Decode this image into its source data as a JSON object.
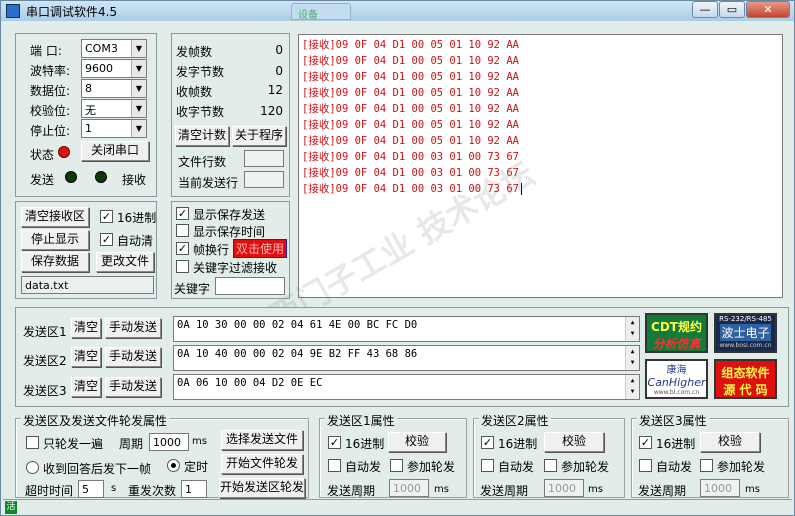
{
  "window": {
    "title": "串口调试软件4.5",
    "ghost_tab": "设备"
  },
  "serial": {
    "port_label": "端  口:",
    "port_value": "COM3",
    "baud_label": "波特率:",
    "baud_value": "9600",
    "databits_label": "数据位:",
    "databits_value": "8",
    "parity_label": "校验位:",
    "parity_value": "无",
    "stopbits_label": "停止位:",
    "stopbits_value": "1",
    "status_label": "状态",
    "close_port_button": "关闭串口",
    "send_label": "发送",
    "recv_label": "接收",
    "status_color": "#e01010"
  },
  "stats": {
    "tx_frames_label": "发帧数",
    "tx_frames": "0",
    "tx_bytes_label": "发字节数",
    "tx_bytes": "0",
    "rx_frames_label": "收帧数",
    "rx_frames": "12",
    "rx_bytes_label": "收字节数",
    "rx_bytes": "120",
    "clear_count_button": "清空计数",
    "about_button": "关于程序",
    "file_lines_label": "文件行数",
    "current_line_label": "当前发送行"
  },
  "recv_controls": {
    "clear_button": "清空接收区",
    "hex_label": "16进制",
    "stop_display_button": "停止显示",
    "auto_clear_label": "自动清",
    "save_data_button": "保存数据",
    "change_file_button": "更改文件",
    "filename": "data.txt"
  },
  "display_options": {
    "show_save_send": "显示保存发送",
    "show_save_time": "显示保存时间",
    "frame_newline": "帧换行",
    "frame_newline_badge": "双击使用",
    "keyword_filter": "关键字过滤接收",
    "keyword_label": "关键字"
  },
  "receive_rows": [
    "[接收]09 0F 04 D1 00 05 01 10 92 AA",
    "[接收]09 0F 04 D1 00 05 01 10 92 AA",
    "[接收]09 0F 04 D1 00 05 01 10 92 AA",
    "[接收]09 0F 04 D1 00 05 01 10 92 AA",
    "[接收]09 0F 04 D1 00 05 01 10 92 AA",
    "[接收]09 0F 04 D1 00 05 01 10 92 AA",
    "[接收]09 0F 04 D1 00 05 01 10 92 AA",
    "[接收]09 0F 04 D1 00 03 01 00 73 67",
    "[接收]09 0F 04 D1 00 03 01 00 73 67",
    "[接收]09 0F 04 D1 00 03 01 00 73 67"
  ],
  "send_areas": [
    {
      "label": "发送区1",
      "clear": "清空",
      "manual": "手动发送",
      "content": "0A 10 30 00 00 02 04 61 4E 00 BC FC D0"
    },
    {
      "label": "发送区2",
      "clear": "清空",
      "manual": "手动发送",
      "content": "0A 10 40 00 00 02 04 9E B2 FF 43  68 86"
    },
    {
      "label": "发送区3",
      "clear": "清空",
      "manual": "手动发送",
      "content": "0A 06 10 00 04 D2 0E EC"
    }
  ],
  "ads": {
    "ad1_line1": "CDT规约",
    "ad1_line2": "分析仿真",
    "ad2_line1": "RS-232/RS-485",
    "ad2_line2": "波士电子",
    "ad2_line3": "www.bosi.com.cn",
    "ad3_line1": "康海",
    "ad3_line2": "CanHigher",
    "ad3_line3": "www.bl.com.cn",
    "ad4_line1": "组态软件",
    "ad4_line2": "源 代 码"
  },
  "send_file_props": {
    "title": "发送区及发送文件轮发属性",
    "send_once": "只轮发一遍",
    "period_label": "周期",
    "period_value": "1000",
    "ms": "ms",
    "select_file_button": "选择发送文件",
    "reply_next": "收到回答后发下一帧",
    "timed": "定时",
    "start_file_button": "开始文件轮发",
    "timeout_label": "超时时间",
    "timeout_value": "5",
    "s": "s",
    "resend_label": "重发次数",
    "resend_value": "1",
    "start_area_button": "开始发送区轮发"
  },
  "area_props": [
    {
      "title": "发送区1属性",
      "hex": "16进制",
      "checksum_button": "校验",
      "auto_send": "自动发",
      "join_round": "参加轮发",
      "period_label": "发送周期",
      "period_value": "1000",
      "ms": "ms"
    },
    {
      "title": "发送区2属性",
      "hex": "16进制",
      "checksum_button": "校验",
      "auto_send": "自动发",
      "join_round": "参加轮发",
      "period_label": "发送周期",
      "period_value": "1000",
      "ms": "ms"
    },
    {
      "title": "发送区3属性",
      "hex": "16进制",
      "checksum_button": "校验",
      "auto_send": "自动发",
      "join_round": "参加轮发",
      "period_label": "发送周期",
      "period_value": "1000",
      "ms": "ms"
    }
  ],
  "statusbar": {
    "icon_char": "活"
  }
}
